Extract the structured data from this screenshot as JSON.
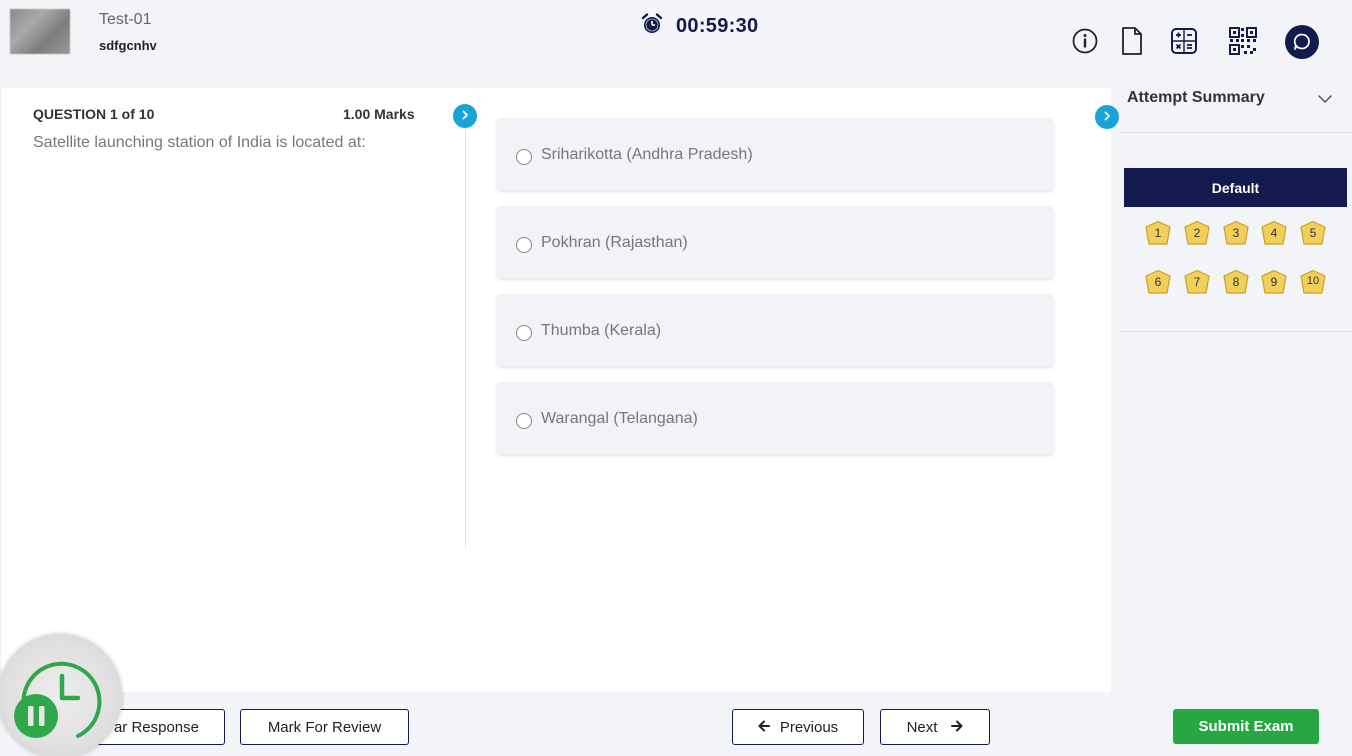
{
  "header": {
    "test_name": "Test-01",
    "user_name": "sdfgcnhv",
    "timer": "00:59:30",
    "icons": [
      "info-icon",
      "document-icon",
      "calculator-icon",
      "qr-code-icon",
      "chat-icon"
    ]
  },
  "question": {
    "heading": "QUESTION 1 of 10",
    "marks": "1.00 Marks",
    "text": "Satellite launching station of India is located at:",
    "options": [
      "Sriharikotta (Andhra Pradesh)",
      "Pokhran (Rajasthan)",
      "Thumba (Kerala)",
      "Warangal (Telangana)"
    ]
  },
  "sidebar": {
    "title": "Attempt Summary",
    "section": "Default",
    "question_numbers": [
      "1",
      "2",
      "3",
      "4",
      "5",
      "6",
      "7",
      "8",
      "9",
      "10"
    ],
    "badge_color": "#f2cf5b"
  },
  "footer": {
    "clear_label": "ar Response",
    "review_label": "Mark For Review",
    "previous_label": "Previous",
    "next_label": "Next",
    "submit_label": "Submit Exam"
  },
  "colors": {
    "navy": "#141a4d",
    "accent_blue": "#1aa3d6",
    "submit_green": "#27a744"
  }
}
